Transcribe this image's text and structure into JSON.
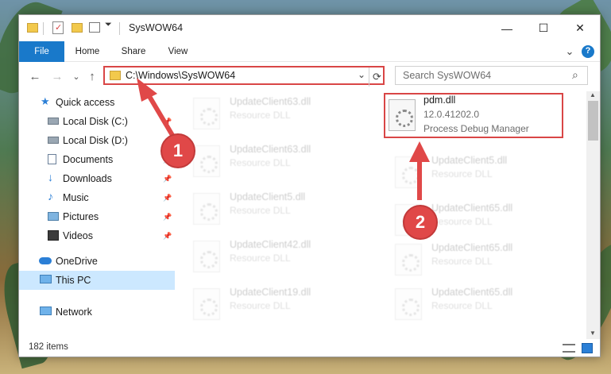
{
  "window": {
    "title": "SysWOW64",
    "controls": {
      "minimize": "—",
      "maximize": "☐",
      "close": "✕"
    }
  },
  "ribbon": {
    "tabs": [
      "File",
      "Home",
      "Share",
      "View"
    ],
    "expand": "⌄",
    "help": "?"
  },
  "address_bar": {
    "path": "C:\\Windows\\SysWOW64",
    "dropdown": "⌄",
    "refresh": "⟳"
  },
  "nav": {
    "back": "←",
    "forward": "→",
    "recent": "⌄",
    "up": "↑"
  },
  "search": {
    "placeholder": "Search SysWOW64",
    "icon": "⌕"
  },
  "sidebar": {
    "items": [
      {
        "label": "Quick access",
        "icon": "star-icon",
        "pinned": false
      },
      {
        "label": "Local Disk (C:)",
        "icon": "drive-icon",
        "pinned": true
      },
      {
        "label": "Local Disk (D:)",
        "icon": "drive-icon",
        "pinned": false
      },
      {
        "label": "Documents",
        "icon": "documents-icon",
        "pinned": true
      },
      {
        "label": "Downloads",
        "icon": "download-icon",
        "pinned": true
      },
      {
        "label": "Music",
        "icon": "music-icon",
        "pinned": true
      },
      {
        "label": "Pictures",
        "icon": "pictures-icon",
        "pinned": true
      },
      {
        "label": "Videos",
        "icon": "videos-icon",
        "pinned": true
      },
      {
        "label": "OneDrive",
        "icon": "cloud-icon",
        "pinned": false
      },
      {
        "label": "This PC",
        "icon": "computer-icon",
        "pinned": false,
        "selected": true
      },
      {
        "label": "Network",
        "icon": "network-icon",
        "pinned": false
      }
    ],
    "pin_glyph": "📌"
  },
  "files": {
    "left_column": [
      {
        "name": "UpdateClient63.dll",
        "type": "Resource DLL"
      },
      {
        "name": "UpdateClient63.dll",
        "type": "Resource DLL"
      },
      {
        "name": "UpdateClient5.dll",
        "type": "Resource DLL"
      },
      {
        "name": "UpdateClient42.dll",
        "type": "Resource DLL"
      },
      {
        "name": "UpdateClient19.dll",
        "type": "Resource DLL"
      }
    ],
    "right_column": [
      {
        "name": "pdm.dll",
        "version": "12.0.41202.0",
        "type": "Process Debug Manager",
        "highlighted": true
      },
      {
        "name": "UpdateClient5.dll",
        "type": "Resource DLL"
      },
      {
        "name": "UpdateClient65.dll",
        "type": "Resource DLL"
      },
      {
        "name": "UpdateClient65.dll",
        "type": "Resource DLL"
      },
      {
        "name": "UpdateClient65.dll",
        "type": "Resource DLL"
      }
    ]
  },
  "status_bar": {
    "item_count": "182 items"
  },
  "markers": [
    "1",
    "2"
  ],
  "colors": {
    "accent": "#1979ca",
    "highlight": "#d94646",
    "selected": "#cce8ff"
  }
}
